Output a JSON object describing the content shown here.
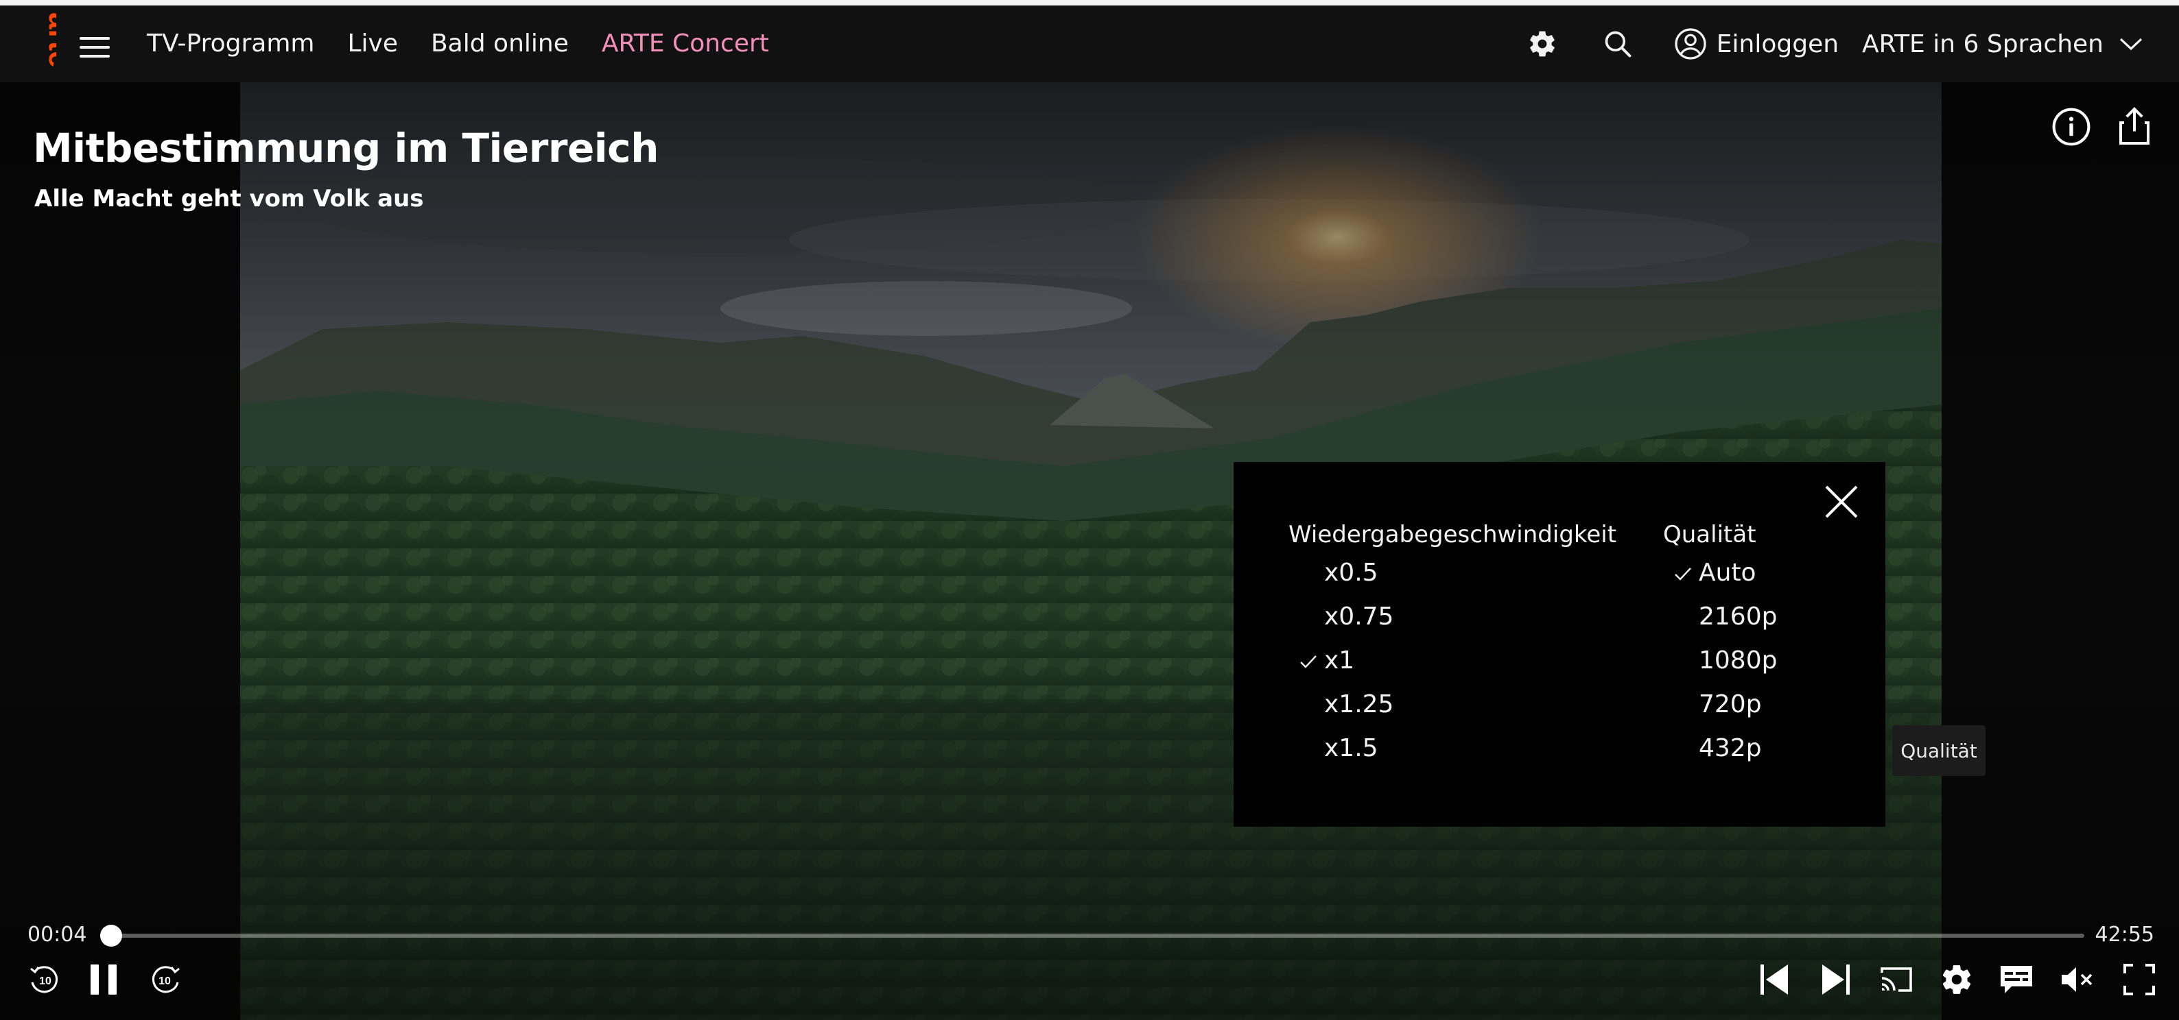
{
  "brand": {
    "logo_text": "arte",
    "accent": "#fd4600"
  },
  "nav": {
    "menu_icon": "hamburger-menu-icon",
    "links": [
      {
        "label": "TV-Programm"
      },
      {
        "label": "Live"
      },
      {
        "label": "Bald online"
      },
      {
        "label": "ARTE Concert",
        "color": "#f48fbb"
      }
    ],
    "settings_icon": "gear-icon",
    "search_icon": "search-icon",
    "login_label": "Einloggen",
    "language_label": "ARTE in 6 Sprachen"
  },
  "video": {
    "title": "Mitbestimmung im Tierreich",
    "subtitle": "Alle Macht geht vom Volk aus",
    "info_icon": "info-icon",
    "share_icon": "share-icon"
  },
  "settings_panel": {
    "speed_title": "Wiedergabegeschwindigkeit",
    "speed_options": [
      {
        "label": "x0.5",
        "selected": false
      },
      {
        "label": "x0.75",
        "selected": false
      },
      {
        "label": "x1",
        "selected": true
      },
      {
        "label": "x1.25",
        "selected": false
      },
      {
        "label": "x1.5",
        "selected": false
      }
    ],
    "quality_title": "Qualität",
    "quality_options": [
      {
        "label": "Auto",
        "selected": true
      },
      {
        "label": "2160p",
        "selected": false
      },
      {
        "label": "1080p",
        "selected": false
      },
      {
        "label": "720p",
        "selected": false
      },
      {
        "label": "432p",
        "selected": false
      }
    ],
    "close_icon": "close-icon",
    "tooltip": "Qualität"
  },
  "player": {
    "time_current": "00:04",
    "time_total": "42:55",
    "progress": 0.0016,
    "rewind_label": "10",
    "forward_label": "10",
    "controls": [
      "rewind-10-icon",
      "pause-icon",
      "forward-10-icon",
      "previous-icon",
      "next-icon",
      "cast-icon",
      "gear-icon",
      "subtitles-icon",
      "mute-icon",
      "fullscreen-icon"
    ]
  }
}
